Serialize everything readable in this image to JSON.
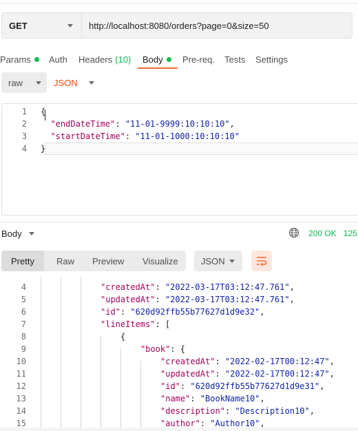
{
  "request": {
    "method": "GET",
    "url": "http://localhost:8080/orders?page=0&size=50"
  },
  "tabs": [
    {
      "label": "Params",
      "dot": true
    },
    {
      "label": "Auth"
    },
    {
      "label": "Headers",
      "count": "(10)"
    },
    {
      "label": "Body",
      "dot": true,
      "active": true
    },
    {
      "label": "Pre-req."
    },
    {
      "label": "Tests"
    },
    {
      "label": "Settings"
    }
  ],
  "body_mode": {
    "type": "raw",
    "language": "JSON"
  },
  "request_body_lines": [
    {
      "n": "1",
      "parts": [
        {
          "t": "{",
          "c": "pun"
        }
      ]
    },
    {
      "n": "2",
      "parts": [
        {
          "t": "  ",
          "c": "pun"
        },
        {
          "t": "\"endDateTime\"",
          "c": "key"
        },
        {
          "t": ": ",
          "c": "pun"
        },
        {
          "t": "\"11-01-9999:10:10:10\"",
          "c": "str"
        },
        {
          "t": ",",
          "c": "pun"
        }
      ]
    },
    {
      "n": "3",
      "parts": [
        {
          "t": "  ",
          "c": "pun"
        },
        {
          "t": "\"startDateTime\"",
          "c": "key"
        },
        {
          "t": ": ",
          "c": "pun"
        },
        {
          "t": "\"11-01-1000:10:10:10\"",
          "c": "str"
        }
      ]
    },
    {
      "n": "4",
      "parts": [
        {
          "t": "}",
          "c": "pun"
        }
      ]
    }
  ],
  "response": {
    "label": "Body",
    "status": "200 OK",
    "size": "125",
    "view_tabs": [
      "Pretty",
      "Raw",
      "Preview",
      "Visualize"
    ],
    "format": "JSON",
    "lines": [
      {
        "n": "4",
        "parts": [
          {
            "t": "\"createdAt\"",
            "c": "key"
          },
          {
            "t": ": ",
            "c": "pun"
          },
          {
            "t": "\"2022-03-17T03:12:47.761\"",
            "c": "str"
          },
          {
            "t": ",",
            "c": "pun"
          }
        ]
      },
      {
        "n": "5",
        "parts": [
          {
            "t": "\"updatedAt\"",
            "c": "key"
          },
          {
            "t": ": ",
            "c": "pun"
          },
          {
            "t": "\"2022-03-17T03:12:47.761\"",
            "c": "str"
          },
          {
            "t": ",",
            "c": "pun"
          }
        ]
      },
      {
        "n": "6",
        "parts": [
          {
            "t": "\"id\"",
            "c": "key"
          },
          {
            "t": ": ",
            "c": "pun"
          },
          {
            "t": "\"620d92ffb55b77627d1d9e32\"",
            "c": "str"
          },
          {
            "t": ",",
            "c": "pun"
          }
        ]
      },
      {
        "n": "7",
        "parts": [
          {
            "t": "\"lineItems\"",
            "c": "key"
          },
          {
            "t": ": [",
            "c": "pun"
          }
        ]
      },
      {
        "n": "8",
        "parts": [
          {
            "t": "{",
            "c": "pun"
          }
        ]
      },
      {
        "n": "9",
        "parts": [
          {
            "t": "\"book\"",
            "c": "key"
          },
          {
            "t": ": {",
            "c": "pun"
          }
        ]
      },
      {
        "n": "10",
        "parts": [
          {
            "t": "\"createdAt\"",
            "c": "key"
          },
          {
            "t": ": ",
            "c": "pun"
          },
          {
            "t": "\"2022-02-17T00:12:47\"",
            "c": "str"
          },
          {
            "t": ",",
            "c": "pun"
          }
        ]
      },
      {
        "n": "11",
        "parts": [
          {
            "t": "\"updatedAt\"",
            "c": "key"
          },
          {
            "t": ": ",
            "c": "pun"
          },
          {
            "t": "\"2022-02-17T00:12:47\"",
            "c": "str"
          },
          {
            "t": ",",
            "c": "pun"
          }
        ]
      },
      {
        "n": "12",
        "parts": [
          {
            "t": "\"id\"",
            "c": "key"
          },
          {
            "t": ": ",
            "c": "pun"
          },
          {
            "t": "\"620d92ffb55b77627d1d9e31\"",
            "c": "str"
          },
          {
            "t": ",",
            "c": "pun"
          }
        ]
      },
      {
        "n": "13",
        "parts": [
          {
            "t": "\"name\"",
            "c": "key"
          },
          {
            "t": ": ",
            "c": "pun"
          },
          {
            "t": "\"BookName10\"",
            "c": "str"
          },
          {
            "t": ",",
            "c": "pun"
          }
        ]
      },
      {
        "n": "14",
        "parts": [
          {
            "t": "\"description\"",
            "c": "key"
          },
          {
            "t": ": ",
            "c": "pun"
          },
          {
            "t": "\"Description10\"",
            "c": "str"
          },
          {
            "t": ",",
            "c": "pun"
          }
        ]
      },
      {
        "n": "15",
        "parts": [
          {
            "t": "\"author\"",
            "c": "key"
          },
          {
            "t": ": ",
            "c": "pun"
          },
          {
            "t": "\"Author10\"",
            "c": "str"
          },
          {
            "t": ",",
            "c": "pun"
          }
        ]
      }
    ]
  },
  "colors": {
    "accent": "#ff6c37",
    "success": "#0cbb52",
    "json_key": "#a3005c",
    "json_string": "#0f22a8"
  }
}
